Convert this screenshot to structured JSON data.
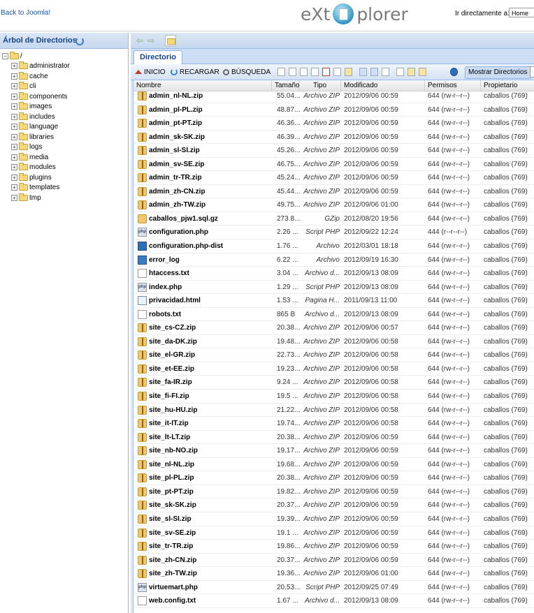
{
  "header": {
    "back_link": "Back to Joomla!",
    "logo_left": "eXt",
    "logo_right": "plorer",
    "goto_label": "Ir directamente a:",
    "goto_value": "Home"
  },
  "tree": {
    "title": "Árbol de Directorios",
    "root": "/",
    "folders": [
      "administrator",
      "cache",
      "cli",
      "components",
      "images",
      "includes",
      "language",
      "libraries",
      "logs",
      "media",
      "modules",
      "plugins",
      "templates",
      "tmp"
    ]
  },
  "tabs": {
    "directory": "Directorio"
  },
  "toolbar": {
    "home": "INICIO",
    "reload": "RECARGAR",
    "search": "BÚSQUEDA",
    "show_dirs": "Mostrar Directorios"
  },
  "grid": {
    "columns": [
      "Nombre",
      "Tamaño",
      "Tipo",
      "Modificado",
      "Permisos",
      "Propietario"
    ],
    "rows": [
      {
        "icon": "zip",
        "name": "admin_nl-NL.zip",
        "size": "55.04...",
        "type": "Archivo ZIP",
        "modified": "2012/09/06 00:59",
        "perms": "644 (rw-r--r--)",
        "owner": "caballos (769)"
      },
      {
        "icon": "zip",
        "name": "admin_pl-PL.zip",
        "size": "48.87...",
        "type": "Archivo ZIP",
        "modified": "2012/09/06 00:59",
        "perms": "644 (rw-r--r--)",
        "owner": "caballos (769)"
      },
      {
        "icon": "zip",
        "name": "admin_pt-PT.zip",
        "size": "46.36...",
        "type": "Archivo ZIP",
        "modified": "2012/09/06 00:59",
        "perms": "644 (rw-r--r--)",
        "owner": "caballos (769)"
      },
      {
        "icon": "zip",
        "name": "admin_sk-SK.zip",
        "size": "46.39...",
        "type": "Archivo ZIP",
        "modified": "2012/09/06 00:59",
        "perms": "644 (rw-r--r--)",
        "owner": "caballos (769)"
      },
      {
        "icon": "zip",
        "name": "admin_sl-SI.zip",
        "size": "45.26...",
        "type": "Archivo ZIP",
        "modified": "2012/09/06 00:59",
        "perms": "644 (rw-r--r--)",
        "owner": "caballos (769)"
      },
      {
        "icon": "zip",
        "name": "admin_sv-SE.zip",
        "size": "46.75...",
        "type": "Archivo ZIP",
        "modified": "2012/09/06 00:59",
        "perms": "644 (rw-r--r--)",
        "owner": "caballos (769)"
      },
      {
        "icon": "zip",
        "name": "admin_tr-TR.zip",
        "size": "45.24...",
        "type": "Archivo ZIP",
        "modified": "2012/09/06 00:59",
        "perms": "644 (rw-r--r--)",
        "owner": "caballos (769)"
      },
      {
        "icon": "zip",
        "name": "admin_zh-CN.zip",
        "size": "45.44...",
        "type": "Archivo ZIP",
        "modified": "2012/09/06 00:59",
        "perms": "644 (rw-r--r--)",
        "owner": "caballos (769)"
      },
      {
        "icon": "zip",
        "name": "admin_zh-TW.zip",
        "size": "49.75...",
        "type": "Archivo ZIP",
        "modified": "2012/09/06 01:00",
        "perms": "644 (rw-r--r--)",
        "owner": "caballos (769)"
      },
      {
        "icon": "gz",
        "name": "caballos_pjw1.sql.gz",
        "size": "273.8...",
        "type": "GZip",
        "modified": "2012/08/20 19:56",
        "perms": "644 (rw-r--r--)",
        "owner": "caballos (769)"
      },
      {
        "icon": "php",
        "name": "configuration.php",
        "size": "2.26 ...",
        "type": "Script PHP",
        "modified": "2012/09/22 12:24",
        "perms": "444 (r--r--r--)",
        "owner": "caballos (769)"
      },
      {
        "icon": "dist",
        "name": "configuration.php-dist",
        "size": "1.76 ...",
        "type": "Archivo",
        "modified": "2012/03/01 18:18",
        "perms": "644 (rw-r--r--)",
        "owner": "caballos (769)"
      },
      {
        "icon": "log",
        "name": "error_log",
        "size": "6.22 ...",
        "type": "Archivo",
        "modified": "2012/09/19 16:30",
        "perms": "644 (rw-r--r--)",
        "owner": "caballos (769)"
      },
      {
        "icon": "txt",
        "name": "htaccess.txt",
        "size": "3.04 ...",
        "type": "Archivo d...",
        "modified": "2012/09/13 08:09",
        "perms": "644 (rw-r--r--)",
        "owner": "caballos (769)"
      },
      {
        "icon": "php",
        "name": "index.php",
        "size": "1.29 ...",
        "type": "Script PHP",
        "modified": "2012/09/13 08:09",
        "perms": "644 (rw-r--r--)",
        "owner": "caballos (769)"
      },
      {
        "icon": "html",
        "name": "privacidad.html",
        "size": "1.53 ...",
        "type": "Pagina H...",
        "modified": "2011/09/13 11:00",
        "perms": "644 (rw-r--r--)",
        "owner": "caballos (769)"
      },
      {
        "icon": "txt",
        "name": "robots.txt",
        "size": "865 B",
        "type": "Archivo d...",
        "modified": "2012/09/13 08:09",
        "perms": "644 (rw-r--r--)",
        "owner": "caballos (769)"
      },
      {
        "icon": "zip",
        "name": "site_cs-CZ.zip",
        "size": "20.38...",
        "type": "Archivo ZIP",
        "modified": "2012/09/06 00:57",
        "perms": "644 (rw-r--r--)",
        "owner": "caballos (769)"
      },
      {
        "icon": "zip",
        "name": "site_da-DK.zip",
        "size": "19.48...",
        "type": "Archivo ZIP",
        "modified": "2012/09/06 00:58",
        "perms": "644 (rw-r--r--)",
        "owner": "caballos (769)"
      },
      {
        "icon": "zip",
        "name": "site_el-GR.zip",
        "size": "22.73...",
        "type": "Archivo ZIP",
        "modified": "2012/09/06 00:58",
        "perms": "644 (rw-r--r--)",
        "owner": "caballos (769)"
      },
      {
        "icon": "zip",
        "name": "site_et-EE.zip",
        "size": "19.23...",
        "type": "Archivo ZIP",
        "modified": "2012/09/06 00:58",
        "perms": "644 (rw-r--r--)",
        "owner": "caballos (769)"
      },
      {
        "icon": "zip",
        "name": "site_fa-IR.zip",
        "size": "9.24 ...",
        "type": "Archivo ZIP",
        "modified": "2012/09/06 00:58",
        "perms": "644 (rw-r--r--)",
        "owner": "caballos (769)"
      },
      {
        "icon": "zip",
        "name": "site_fi-FI.zip",
        "size": "19.5 ...",
        "type": "Archivo ZIP",
        "modified": "2012/09/06 00:58",
        "perms": "644 (rw-r--r--)",
        "owner": "caballos (769)"
      },
      {
        "icon": "zip",
        "name": "site_hu-HU.zip",
        "size": "21.22...",
        "type": "Archivo ZIP",
        "modified": "2012/09/06 00:58",
        "perms": "644 (rw-r--r--)",
        "owner": "caballos (769)"
      },
      {
        "icon": "zip",
        "name": "site_it-IT.zip",
        "size": "19.74...",
        "type": "Archivo ZIP",
        "modified": "2012/09/06 00:58",
        "perms": "644 (rw-r--r--)",
        "owner": "caballos (769)"
      },
      {
        "icon": "zip",
        "name": "site_lt-LT.zip",
        "size": "20.38...",
        "type": "Archivo ZIP",
        "modified": "2012/09/06 00:59",
        "perms": "644 (rw-r--r--)",
        "owner": "caballos (769)"
      },
      {
        "icon": "zip",
        "name": "site_nb-NO.zip",
        "size": "19.17...",
        "type": "Archivo ZIP",
        "modified": "2012/09/06 00:59",
        "perms": "644 (rw-r--r--)",
        "owner": "caballos (769)"
      },
      {
        "icon": "zip",
        "name": "site_nl-NL.zip",
        "size": "19.68...",
        "type": "Archivo ZIP",
        "modified": "2012/09/06 00:59",
        "perms": "644 (rw-r--r--)",
        "owner": "caballos (769)"
      },
      {
        "icon": "zip",
        "name": "site_pl-PL.zip",
        "size": "20.38...",
        "type": "Archivo ZIP",
        "modified": "2012/09/06 00:59",
        "perms": "644 (rw-r--r--)",
        "owner": "caballos (769)"
      },
      {
        "icon": "zip",
        "name": "site_pt-PT.zip",
        "size": "19.82...",
        "type": "Archivo ZIP",
        "modified": "2012/09/06 00:59",
        "perms": "644 (rw-r--r--)",
        "owner": "caballos (769)"
      },
      {
        "icon": "zip",
        "name": "site_sk-SK.zip",
        "size": "20.37...",
        "type": "Archivo ZIP",
        "modified": "2012/09/06 00:59",
        "perms": "644 (rw-r--r--)",
        "owner": "caballos (769)"
      },
      {
        "icon": "zip",
        "name": "site_sl-SI.zip",
        "size": "19.39...",
        "type": "Archivo ZIP",
        "modified": "2012/09/06 00:59",
        "perms": "644 (rw-r--r--)",
        "owner": "caballos (769)"
      },
      {
        "icon": "zip",
        "name": "site_sv-SE.zip",
        "size": "19.1 ...",
        "type": "Archivo ZIP",
        "modified": "2012/09/06 00:59",
        "perms": "644 (rw-r--r--)",
        "owner": "caballos (769)"
      },
      {
        "icon": "zip",
        "name": "site_tr-TR.zip",
        "size": "19.86...",
        "type": "Archivo ZIP",
        "modified": "2012/09/06 00:59",
        "perms": "644 (rw-r--r--)",
        "owner": "caballos (769)"
      },
      {
        "icon": "zip",
        "name": "site_zh-CN.zip",
        "size": "20.37...",
        "type": "Archivo ZIP",
        "modified": "2012/09/06 00:59",
        "perms": "644 (rw-r--r--)",
        "owner": "caballos (769)"
      },
      {
        "icon": "zip",
        "name": "site_zh-TW.zip",
        "size": "19.36...",
        "type": "Archivo ZIP",
        "modified": "2012/09/06 01:00",
        "perms": "644 (rw-r--r--)",
        "owner": "caballos (769)"
      },
      {
        "icon": "php",
        "name": "virtuemart.php",
        "size": "20.53...",
        "type": "Script PHP",
        "modified": "2012/09/25 07:49",
        "perms": "644 (rw-r--r--)",
        "owner": "caballos (769)"
      },
      {
        "icon": "txt",
        "name": "web.config.txt",
        "size": "1.67 ...",
        "type": "Archivo d...",
        "modified": "2012/09/13 08:09",
        "perms": "644 (rw-r--r--)",
        "owner": "caballos (769)"
      }
    ]
  },
  "colors": {
    "accent": "#15428b",
    "panel_border": "#99bbe8",
    "link": "#1a55a8"
  }
}
